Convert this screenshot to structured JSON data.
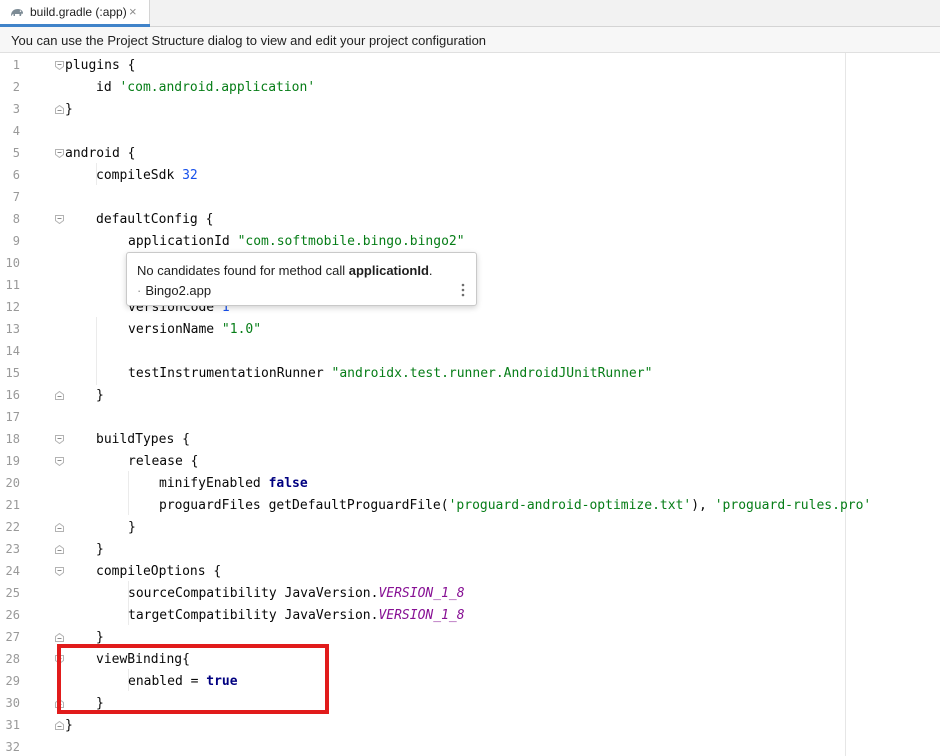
{
  "tab": {
    "icon": "gradle-elephant-icon",
    "label": "build.gradle (:app)",
    "close_glyph": "×"
  },
  "banner": {
    "text": "You can use the Project Structure dialog to view and edit your project configuration"
  },
  "editor": {
    "lines": [
      {
        "n": "1",
        "tokens": [
          [
            "plugins {",
            ""
          ]
        ]
      },
      {
        "n": "2",
        "tokens": [
          [
            "id ",
            ""
          ],
          [
            "'com.android.application'",
            "str"
          ]
        ]
      },
      {
        "n": "3",
        "tokens": [
          [
            "}",
            ""
          ]
        ]
      },
      {
        "n": "4",
        "tokens": []
      },
      {
        "n": "5",
        "tokens": [
          [
            "android {",
            ""
          ]
        ]
      },
      {
        "n": "6",
        "tokens": [
          [
            "compileSdk ",
            ""
          ],
          [
            "32",
            "num"
          ]
        ]
      },
      {
        "n": "7",
        "tokens": []
      },
      {
        "n": "8",
        "tokens": [
          [
            "defaultConfig {",
            ""
          ]
        ]
      },
      {
        "n": "9",
        "tokens": [
          [
            "applicationId ",
            ""
          ],
          [
            "\"com.softmobile.bingo.bingo2\"",
            "str"
          ]
        ]
      },
      {
        "n": "10",
        "tokens": []
      },
      {
        "n": "11",
        "tokens": []
      },
      {
        "n": "12",
        "tokens": [
          [
            "versionCode ",
            ""
          ],
          [
            "1",
            "num"
          ]
        ]
      },
      {
        "n": "13",
        "tokens": [
          [
            "versionName ",
            ""
          ],
          [
            "\"1.0\"",
            "str"
          ]
        ]
      },
      {
        "n": "14",
        "tokens": []
      },
      {
        "n": "15",
        "tokens": [
          [
            "testInstrumentationRunner ",
            ""
          ],
          [
            "\"androidx.test.runner.AndroidJUnitRunner\"",
            "str"
          ]
        ]
      },
      {
        "n": "16",
        "tokens": [
          [
            "}",
            ""
          ]
        ]
      },
      {
        "n": "17",
        "tokens": []
      },
      {
        "n": "18",
        "tokens": [
          [
            "buildTypes {",
            ""
          ]
        ]
      },
      {
        "n": "19",
        "tokens": [
          [
            "release {",
            ""
          ]
        ]
      },
      {
        "n": "20",
        "tokens": [
          [
            "minifyEnabled ",
            ""
          ],
          [
            "false",
            "kw2"
          ]
        ]
      },
      {
        "n": "21",
        "tokens": [
          [
            "proguardFiles getDefaultProguardFile(",
            ""
          ],
          [
            "'proguard-android-optimize.txt'",
            "str"
          ],
          [
            "), ",
            ""
          ],
          [
            "'proguard-rules.pro'",
            "str"
          ]
        ]
      },
      {
        "n": "22",
        "tokens": [
          [
            "}",
            ""
          ]
        ]
      },
      {
        "n": "23",
        "tokens": [
          [
            "}",
            ""
          ]
        ]
      },
      {
        "n": "24",
        "tokens": [
          [
            "compileOptions {",
            ""
          ]
        ]
      },
      {
        "n": "25",
        "tokens": [
          [
            "sourceCompatibility JavaVersion.",
            ""
          ],
          [
            "VERSION_1_8",
            "stat"
          ]
        ]
      },
      {
        "n": "26",
        "tokens": [
          [
            "targetCompatibility JavaVersion.",
            ""
          ],
          [
            "VERSION_1_8",
            "stat"
          ]
        ]
      },
      {
        "n": "27",
        "tokens": [
          [
            "}",
            ""
          ]
        ]
      },
      {
        "n": "28",
        "tokens": [
          [
            "viewBinding{",
            ""
          ]
        ]
      },
      {
        "n": "29",
        "tokens": [
          [
            "enabled = ",
            ""
          ],
          [
            "true",
            "kw2"
          ]
        ]
      },
      {
        "n": "30",
        "tokens": [
          [
            "}",
            ""
          ]
        ]
      },
      {
        "n": "31",
        "tokens": [
          [
            "}",
            ""
          ]
        ]
      },
      {
        "n": "32",
        "tokens": []
      }
    ]
  },
  "tooltip": {
    "message_prefix": "No candidates found for method call ",
    "message_method": "applicationId",
    "message_suffix": ".",
    "location_dot": "·",
    "location": "Bingo2.app",
    "more_icon": "more-vertical-icon"
  },
  "colors": {
    "string": "#067d17",
    "number": "#1750eb",
    "keyword": "#000080",
    "static_field": "#871094",
    "highlight_box": "#e11b1b",
    "tab_underline": "#4083c9"
  }
}
